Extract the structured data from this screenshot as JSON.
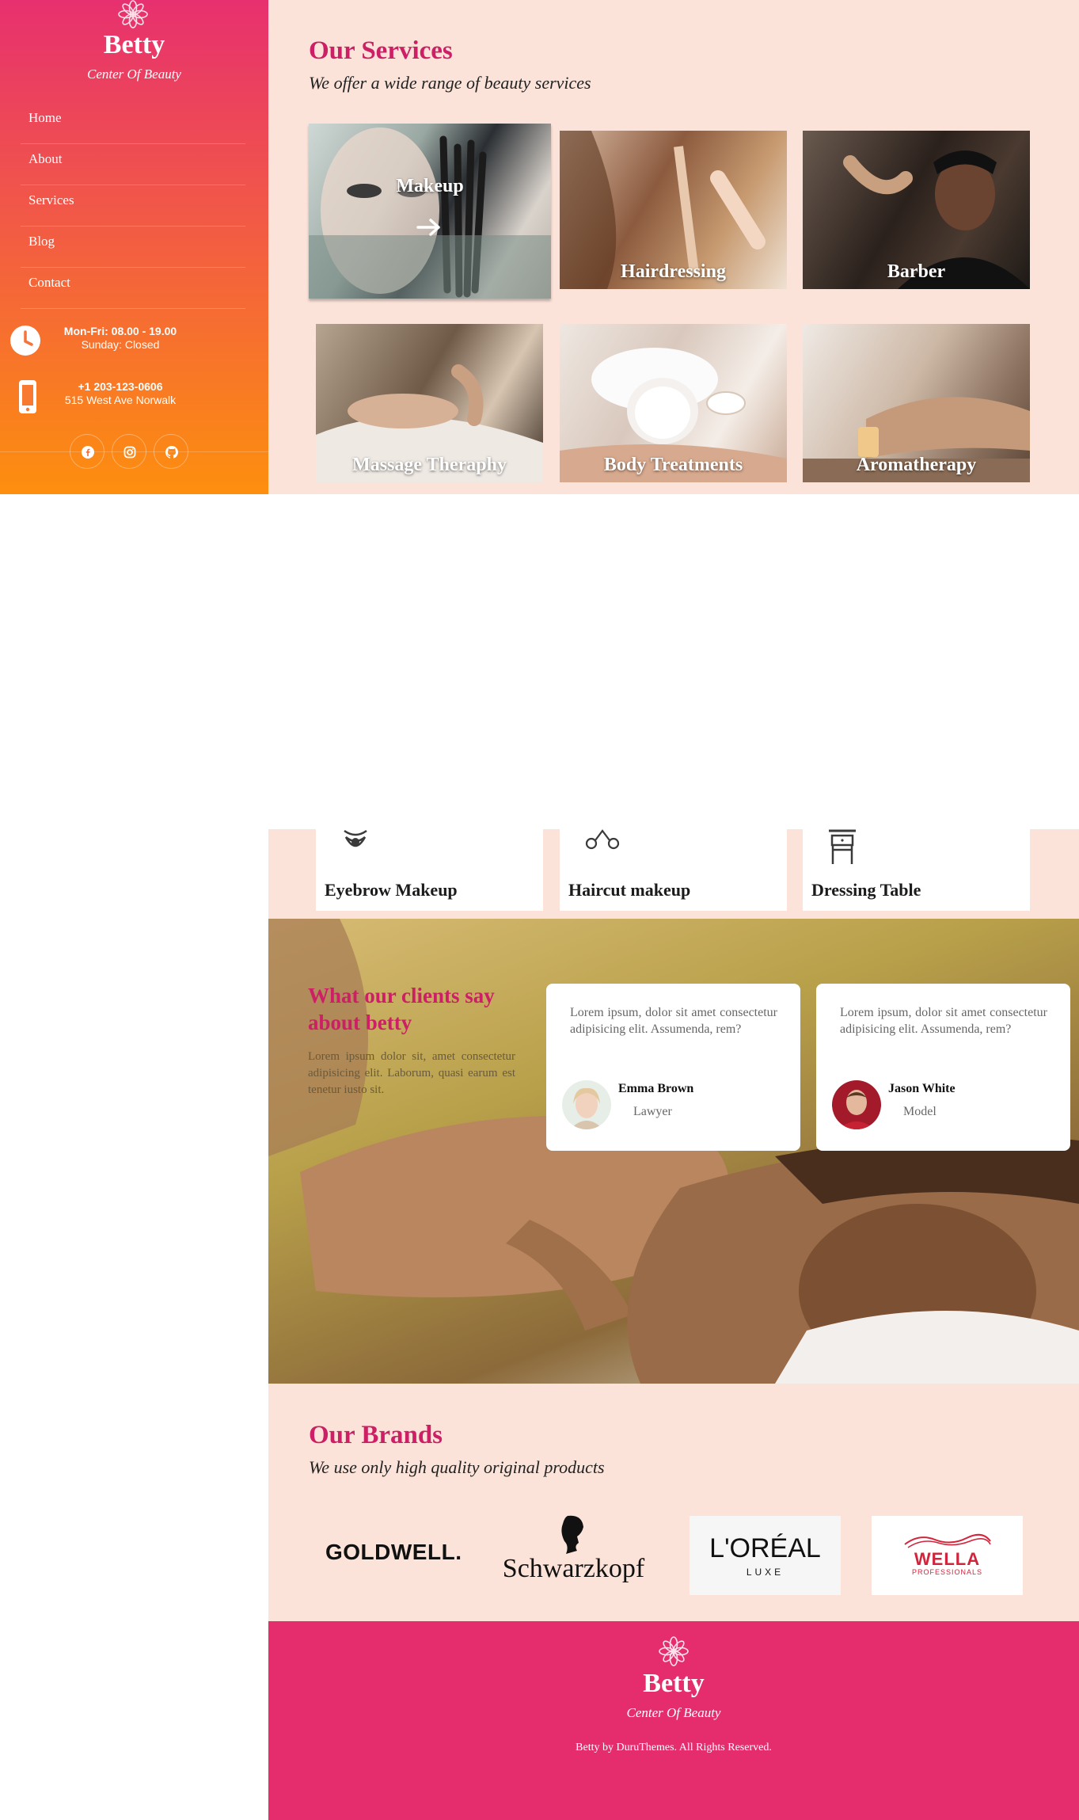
{
  "sidebar": {
    "brand_name": "Betty",
    "brand_tagline": "Center Of Beauty",
    "nav": [
      {
        "label": "Home"
      },
      {
        "label": "About"
      },
      {
        "label": "Services"
      },
      {
        "label": "Blog"
      },
      {
        "label": "Contact"
      }
    ],
    "hours": {
      "line1": "Mon-Fri: 08.00 - 19.00",
      "line2": "Sunday: Closed"
    },
    "contact": {
      "phone": "+1 203-123-0606",
      "address": "515 West Ave Norwalk"
    },
    "socials": [
      {
        "icon": "facebook-icon"
      },
      {
        "icon": "instagram-icon"
      },
      {
        "icon": "github-icon"
      }
    ],
    "colors": {
      "gradient_top": "#e7306f",
      "gradient_bottom": "#fd8f0e"
    }
  },
  "services": {
    "title": "Our Services",
    "subtitle": "We offer a wide range of beauty services",
    "items": [
      {
        "label": "Makeup"
      },
      {
        "label": "Hairdressing"
      },
      {
        "label": "Barber"
      },
      {
        "label": "Massage Theraphy"
      },
      {
        "label": "Body Treatments"
      },
      {
        "label": "Aromatherapy"
      }
    ]
  },
  "tools": [
    {
      "label": "Eyebrow Makeup",
      "icon": "eyebrow-icon"
    },
    {
      "label": "Haircut makeup",
      "icon": "scissors-icon"
    },
    {
      "label": "Dressing Table",
      "icon": "dressing-table-icon"
    }
  ],
  "testimonials": {
    "title": "What our clients say about betty",
    "text": "Lorem ipsum dolor sit, amet consectetur adipisicing elit. Laborum, quasi earum est tenetur iusto sit.",
    "items": [
      {
        "text": "Lorem ipsum, dolor sit amet consectetur adipisicing elit. Assumenda, rem?",
        "name": "Emma Brown",
        "role": "Lawyer"
      },
      {
        "text": "Lorem ipsum, dolor sit amet consectetur adipisicing elit. Assumenda, rem?",
        "name": "Jason White",
        "role": "Model"
      }
    ]
  },
  "brands": {
    "title": "Our Brands",
    "subtitle": "We use only high quality original products",
    "logos": [
      {
        "name": "GOLDWELL."
      },
      {
        "name": "Schwarzkopf"
      },
      {
        "name": "L'ORÉAL",
        "sub": "LUXE"
      },
      {
        "name": "WELLA",
        "sub": "PROFESSIONALS"
      }
    ]
  },
  "footer": {
    "brand_name": "Betty",
    "brand_tagline": "Center Of Beauty",
    "copyright": "Betty by DuruThemes. All Rights Reserved."
  },
  "colors": {
    "accent": "#cc1f65",
    "peach_bg": "#fce3d9",
    "footer_bg": "#e52d6e"
  }
}
